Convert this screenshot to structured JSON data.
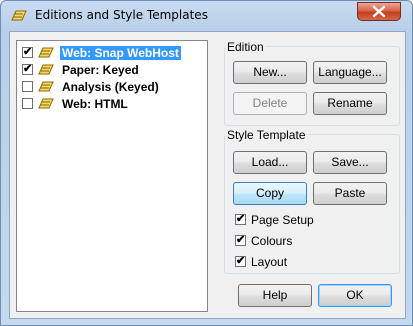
{
  "window": {
    "title": "Editions and Style Templates"
  },
  "editions": [
    {
      "label": "Web: Snap WebHost",
      "checked": true,
      "selected": true
    },
    {
      "label": "Paper: Keyed",
      "checked": true,
      "selected": false
    },
    {
      "label": "Analysis (Keyed)",
      "checked": false,
      "selected": false
    },
    {
      "label": "Web: HTML",
      "checked": false,
      "selected": false
    }
  ],
  "edition_group": {
    "title": "Edition",
    "new_label": "New...",
    "language_label": "Language...",
    "delete_label": "Delete",
    "rename_label": "Rename"
  },
  "style_group": {
    "title": "Style Template",
    "load_label": "Load...",
    "save_label": "Save...",
    "copy_label": "Copy",
    "paste_label": "Paste",
    "options": [
      {
        "label": "Page Setup",
        "checked": true
      },
      {
        "label": "Colours",
        "checked": true
      },
      {
        "label": "Layout",
        "checked": true
      }
    ]
  },
  "footer": {
    "help_label": "Help",
    "ok_label": "OK"
  },
  "colors": {
    "selection": "#3399ff",
    "close": "#c43d22",
    "icon": "#e0b200"
  },
  "icons": {
    "edition": "edition-icon",
    "close": "close-icon"
  }
}
